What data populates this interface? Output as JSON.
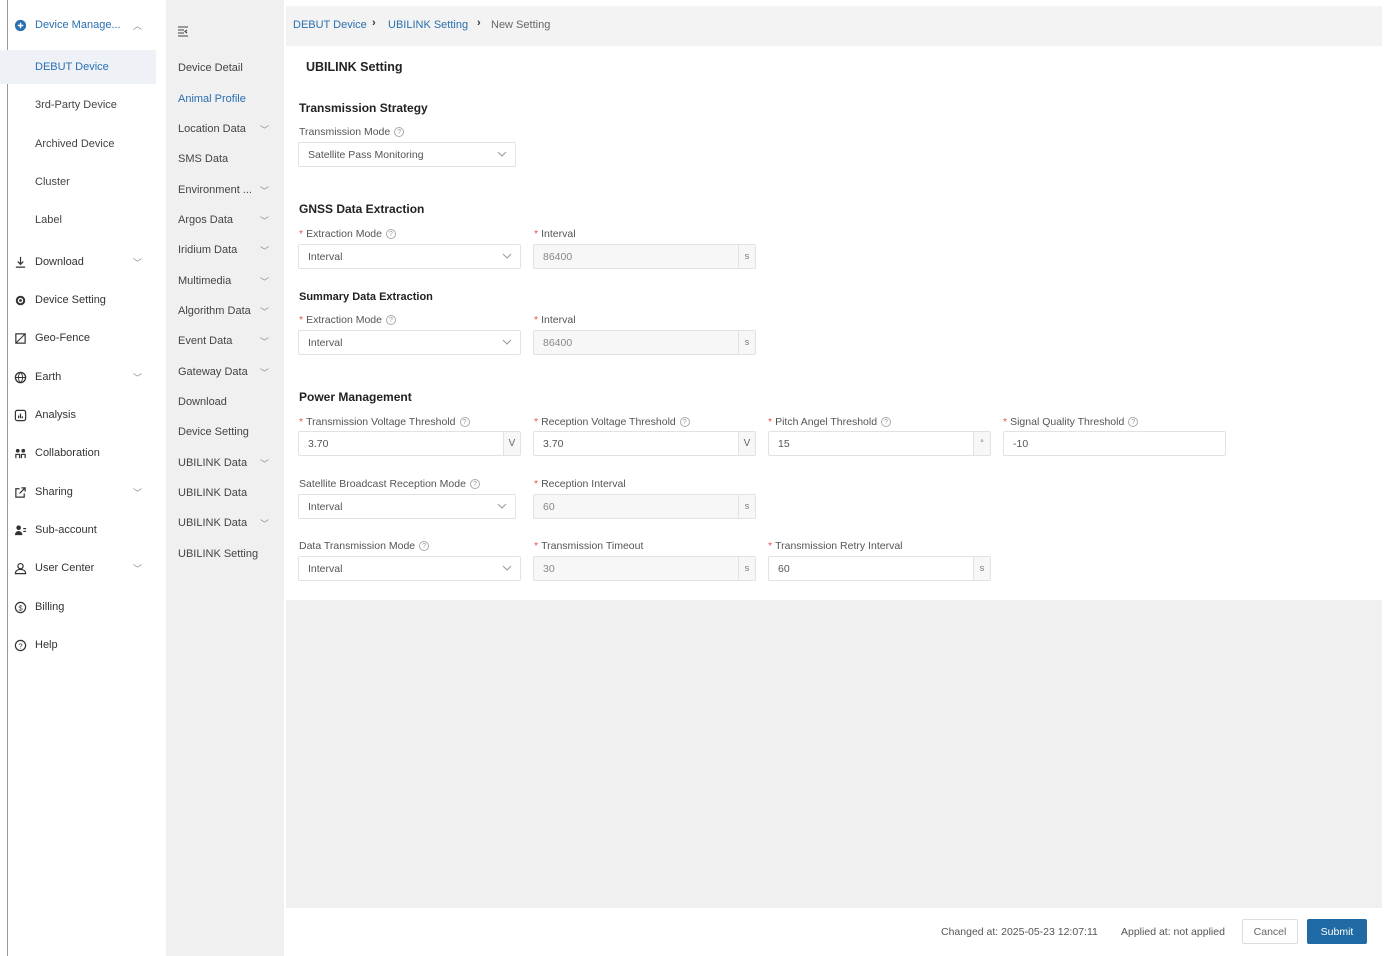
{
  "nav": {
    "device_manage": "Device Manage...",
    "debut_device": "DEBUT Device",
    "third_party": "3rd-Party Device",
    "archived": "Archived Device",
    "cluster": "Cluster",
    "label": "Label",
    "download": "Download",
    "device_setting": "Device Setting",
    "geo_fence": "Geo-Fence",
    "earth": "Earth",
    "analysis": "Analysis",
    "collaboration": "Collaboration",
    "sharing": "Sharing",
    "sub_account": "Sub-account",
    "user_center": "User Center",
    "billing": "Billing",
    "help": "Help"
  },
  "subnav": {
    "device_detail": "Device Detail",
    "animal_profile": "Animal Profile",
    "location_data": "Location Data",
    "sms_data": "SMS Data",
    "environment": "Environment ...",
    "argos_data": "Argos Data",
    "iridium_data": "Iridium Data",
    "multimedia": "Multimedia",
    "algorithm_data": "Algorithm Data",
    "event_data": "Event Data",
    "gateway_data": "Gateway Data",
    "download": "Download",
    "device_setting": "Device Setting",
    "ubilink_data_1": "UBILINK Data",
    "ubilink_data_2": "UBILINK Data",
    "ubilink_data_3": "UBILINK Data",
    "ubilink_setting": "UBILINK Setting"
  },
  "breadcrumb": {
    "item1": "DEBUT Device",
    "item2": "UBILINK Setting",
    "item3": "New Setting"
  },
  "form": {
    "title": "UBILINK Setting",
    "transmission_strategy": {
      "heading": "Transmission Strategy",
      "mode_label": "Transmission Mode",
      "mode_value": "Satellite Pass Monitoring"
    },
    "gnss": {
      "heading": "GNSS Data Extraction",
      "mode_label": "Extraction Mode",
      "mode_value": "Interval",
      "interval_label": "Interval",
      "interval_value": "86400",
      "unit": "s"
    },
    "summary": {
      "heading": "Summary Data Extraction",
      "mode_label": "Extraction Mode",
      "mode_value": "Interval",
      "interval_label": "Interval",
      "interval_value": "86400",
      "unit": "s"
    },
    "power": {
      "heading": "Power Management",
      "tx_voltage_label": "Transmission Voltage Threshold",
      "tx_voltage_value": "3.70",
      "tx_voltage_unit": "V",
      "rx_voltage_label": "Reception Voltage Threshold",
      "rx_voltage_value": "3.70",
      "rx_voltage_unit": "V",
      "pitch_label": "Pitch Angel Threshold",
      "pitch_value": "15",
      "pitch_unit": "°",
      "signal_label": "Signal Quality Threshold",
      "signal_value": "-10",
      "broadcast_mode_label": "Satellite Broadcast Reception Mode",
      "broadcast_mode_value": "Interval",
      "reception_interval_label": "Reception Interval",
      "reception_interval_value": "60",
      "reception_interval_unit": "s",
      "data_tx_mode_label": "Data Transmission Mode",
      "data_tx_mode_value": "Interval",
      "tx_timeout_label": "Transmission Timeout",
      "tx_timeout_value": "30",
      "tx_timeout_unit": "s",
      "retry_label": "Transmission Retry Interval",
      "retry_value": "60",
      "retry_unit": "s"
    }
  },
  "footer": {
    "changed_at": "Changed at: 2025-05-23 12:07:11",
    "applied_at": "Applied at: not applied",
    "cancel": "Cancel",
    "submit": "Submit"
  },
  "colors": {
    "accent": "#2a6fb0",
    "primary_button": "#1f6aa5",
    "required": "#e35555"
  }
}
